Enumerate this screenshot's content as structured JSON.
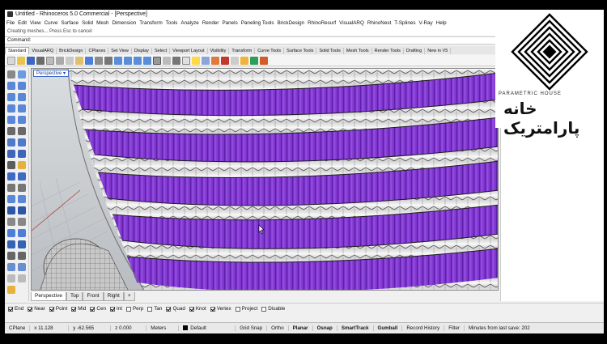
{
  "window": {
    "title": "Untitled - Rhinoceros 5.0 Commercial - [Perspective]"
  },
  "menu": [
    "File",
    "Edit",
    "View",
    "Curve",
    "Surface",
    "Solid",
    "Mesh",
    "Dimension",
    "Transform",
    "Tools",
    "Analyze",
    "Render",
    "Panels",
    "Paneling Tools",
    "BrickDesign",
    "RhinoResurf",
    "VisualARQ",
    "RhinoNest",
    "T-Splines",
    "V-Ray",
    "Help"
  ],
  "command_history": "Creating meshes... Press Esc to cancel",
  "command_prompt": "Command:",
  "toolbar_tabs": [
    "Standard",
    "VisualARQ",
    "BrickDesign",
    "CPlanes",
    "Set View",
    "Display",
    "Select",
    "Viewport Layout",
    "Visibility",
    "Transform",
    "Curve Tools",
    "Surface Tools",
    "Solid Tools",
    "Mesh Tools",
    "Render Tools",
    "Drafting",
    "New in V5"
  ],
  "viewport": {
    "label": "Perspective",
    "label_arrow": "▾"
  },
  "view_tabs": [
    "Perspective",
    "Top",
    "Front",
    "Right",
    "+"
  ],
  "osnaps": [
    {
      "label": "End",
      "checked": true
    },
    {
      "label": "Near",
      "checked": true
    },
    {
      "label": "Point",
      "checked": true
    },
    {
      "label": "Mid",
      "checked": true
    },
    {
      "label": "Cen",
      "checked": true
    },
    {
      "label": "Int",
      "checked": true
    },
    {
      "label": "Perp",
      "checked": false
    },
    {
      "label": "Tan",
      "checked": false
    },
    {
      "label": "Quad",
      "checked": true
    },
    {
      "label": "Knot",
      "checked": true
    },
    {
      "label": "Vertex",
      "checked": true
    },
    {
      "label": "Project",
      "checked": false
    },
    {
      "label": "Disable",
      "checked": false
    }
  ],
  "status": {
    "cplane": "CPlane",
    "x": "x 11.128",
    "y": "y -62.565",
    "z": "z 0.000",
    "units": "Meters",
    "layer": "Default",
    "toggles": [
      "Grid Snap",
      "Ortho",
      "Planar",
      "Osnap",
      "SmartTrack",
      "Gumball",
      "Record History",
      "Filter"
    ],
    "bold_toggles": [
      "Planar",
      "Osnap",
      "SmartTrack",
      "Gumball"
    ],
    "message": "Minutes from last save: 202"
  },
  "brand": {
    "english": "PARAMETRIC HOUSE",
    "persian": "خانه پارامتریک"
  },
  "colors": {
    "purple": "#7a2fc9",
    "selection_blue": "#3a6bc8"
  }
}
